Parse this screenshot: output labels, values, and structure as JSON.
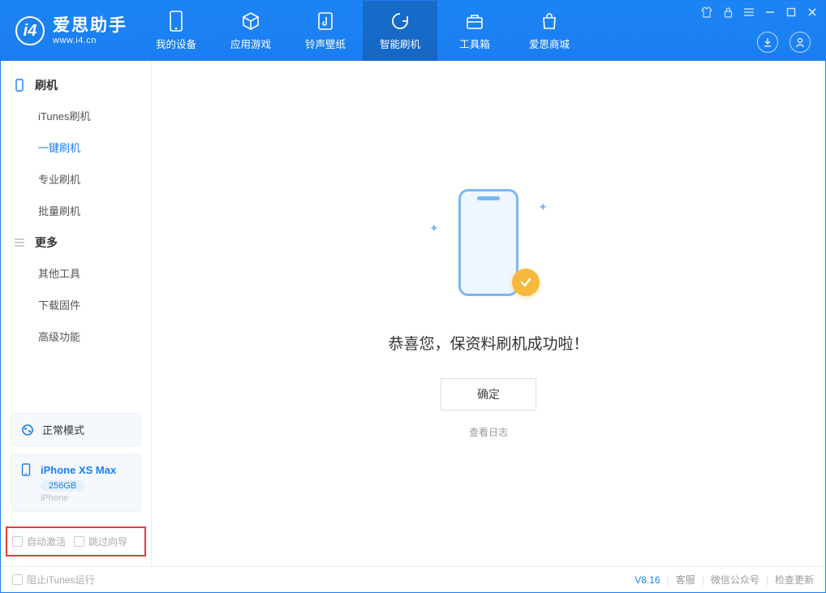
{
  "header": {
    "app_name": "爱思助手",
    "app_url": "www.i4.cn",
    "tabs": [
      "我的设备",
      "应用游戏",
      "铃声壁纸",
      "智能刷机",
      "工具箱",
      "爱思商城"
    ]
  },
  "sidebar": {
    "groups": [
      {
        "title": "刷机",
        "items": [
          "iTunes刷机",
          "一键刷机",
          "专业刷机",
          "批量刷机"
        ]
      },
      {
        "title": "更多",
        "items": [
          "其他工具",
          "下载固件",
          "高级功能"
        ]
      }
    ],
    "device_mode": "正常模式",
    "device": {
      "name": "iPhone XS Max",
      "capacity": "256GB",
      "type": "iPhone"
    },
    "options": [
      "自动激活",
      "跳过向导"
    ]
  },
  "main": {
    "success_message": "恭喜您，保资料刷机成功啦！",
    "ok_button": "确定",
    "view_log": "查看日志"
  },
  "footer": {
    "block_itunes": "阻止iTunes运行",
    "version": "V8.16",
    "links": [
      "客服",
      "微信公众号",
      "检查更新"
    ]
  }
}
